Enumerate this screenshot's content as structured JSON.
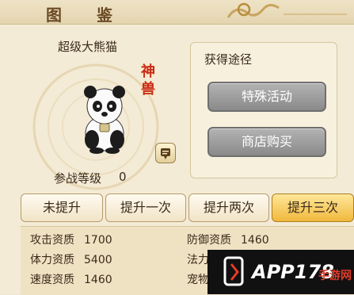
{
  "header": {
    "title_left": "图",
    "title_right": "鉴"
  },
  "pet": {
    "name": "超级大熊猫",
    "badge_line1": "神",
    "badge_line2": "兽",
    "level_label": "参战等级",
    "level_value": "0"
  },
  "source": {
    "title": "获得途径",
    "buttons": [
      "特殊活动",
      "商店购买"
    ]
  },
  "tabs": [
    {
      "label": "未提升"
    },
    {
      "label": "提升一次"
    },
    {
      "label": "提升两次"
    },
    {
      "label": "提升三次"
    }
  ],
  "stats": [
    {
      "label": "攻击资质",
      "value": "1700"
    },
    {
      "label": "防御资质",
      "value": "1460"
    },
    {
      "label": "体力资质",
      "value": "5400"
    },
    {
      "label": "法力资",
      "value": ""
    },
    {
      "label": "速度资质",
      "value": "1460"
    },
    {
      "label": "宠物成",
      "value": ""
    }
  ],
  "watermark": {
    "text": "APP178",
    "sub": "手游网"
  },
  "colors": {
    "active_tab": "#f0b83c",
    "source_button": "#8a8a8a",
    "badge": "#c72b1c"
  }
}
